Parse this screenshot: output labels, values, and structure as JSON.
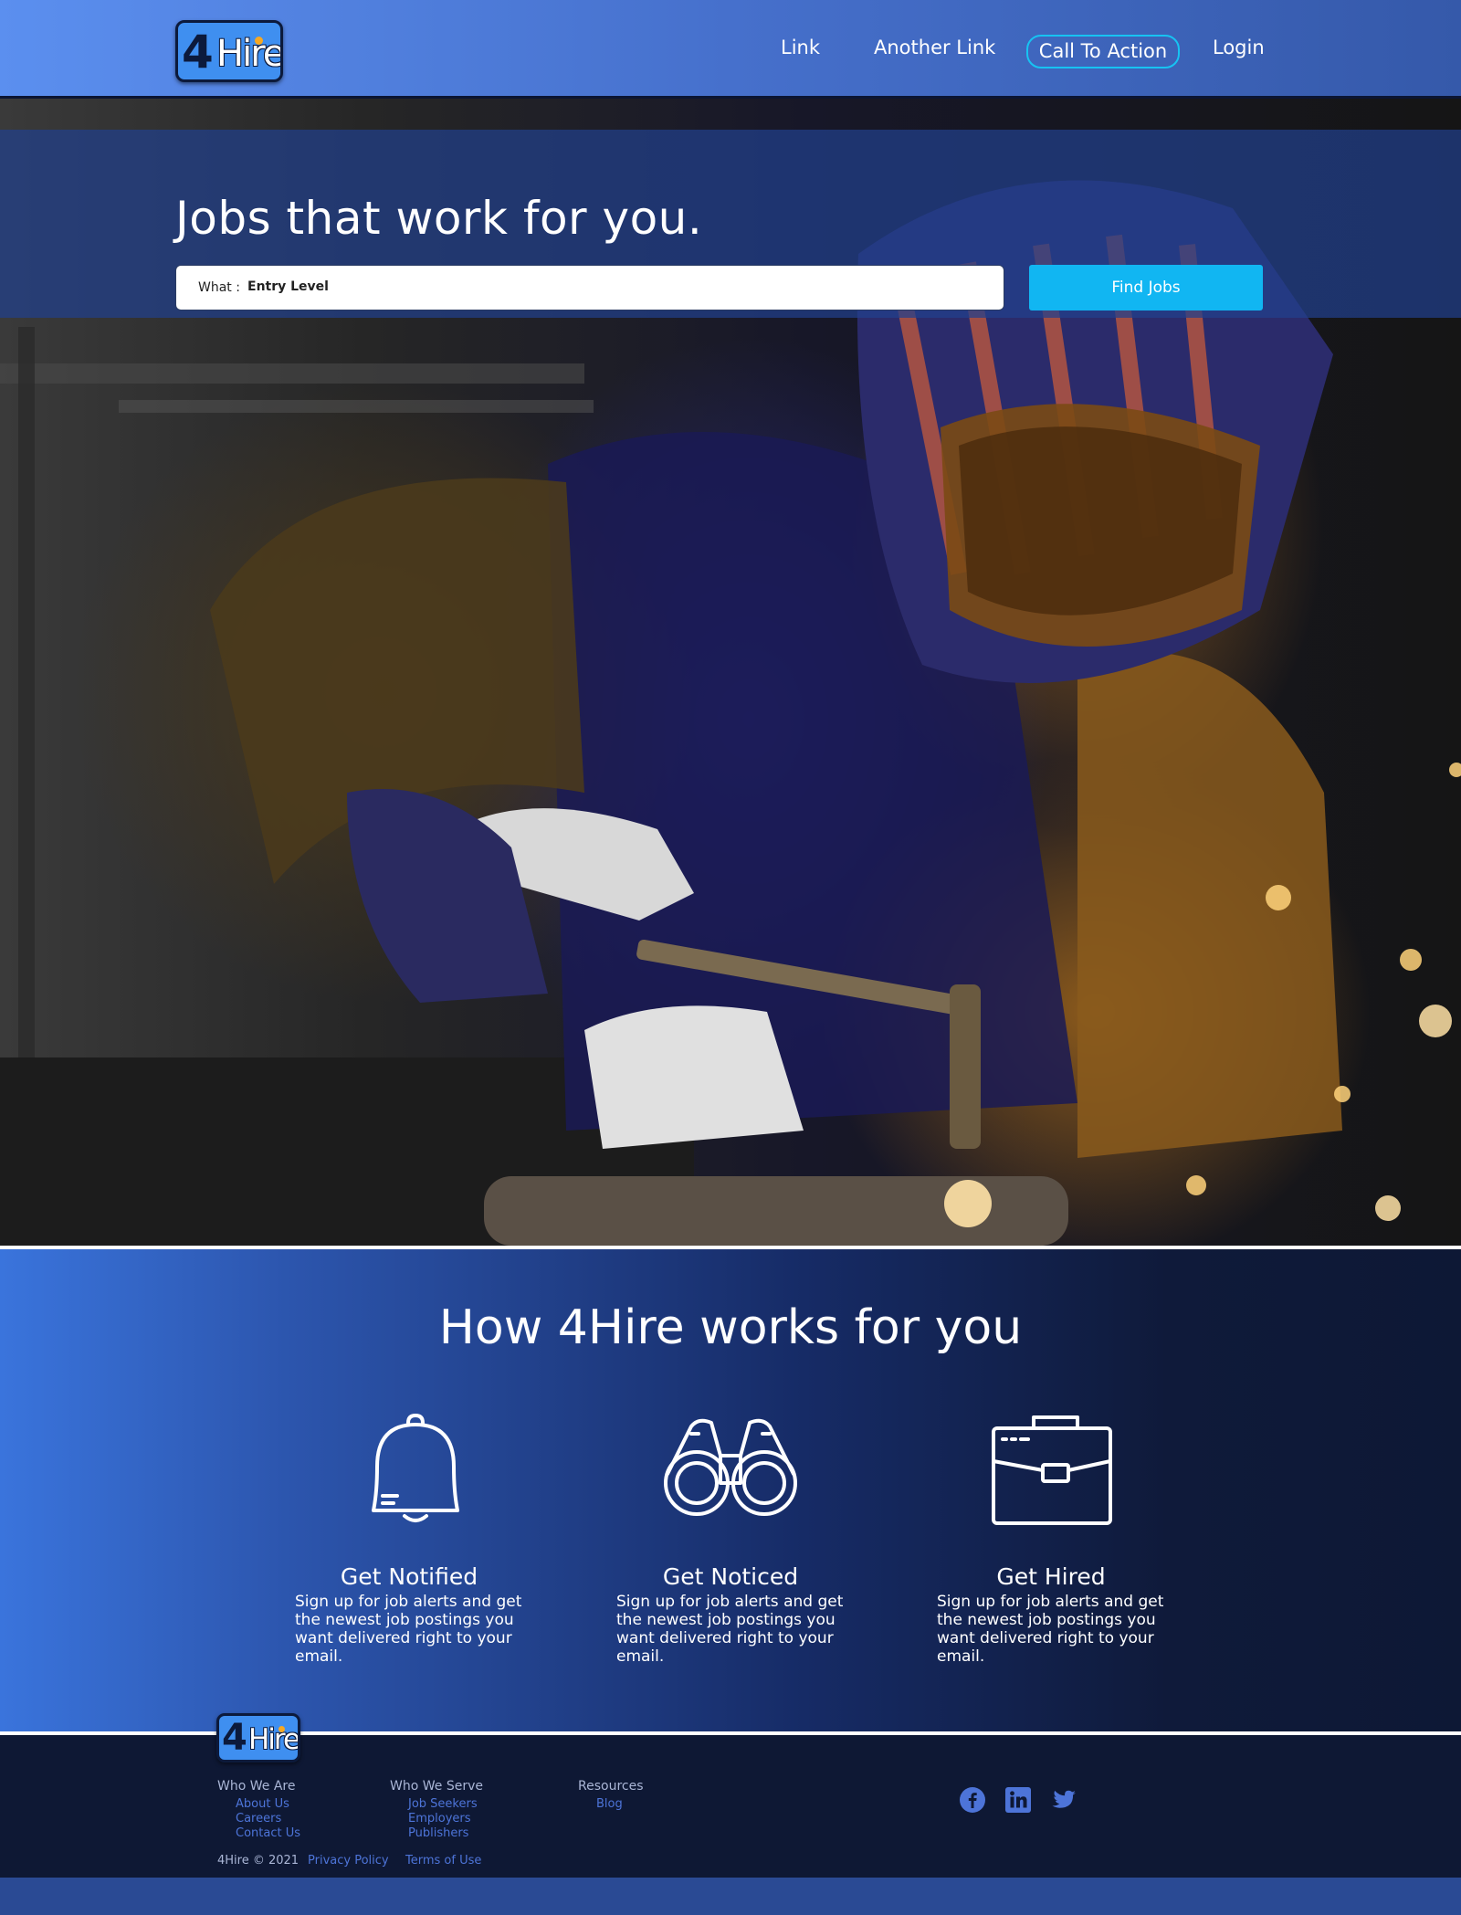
{
  "nav": {
    "logo_four": "4",
    "logo_hire": "Hire",
    "links": [
      "Link",
      "Another Link"
    ],
    "cta": "Call To Action",
    "login": "Login"
  },
  "hero": {
    "title": "Jobs that work for you.",
    "search": {
      "label": "What :",
      "value": "Entry Level"
    },
    "find_button": "Find Jobs"
  },
  "how": {
    "title": "How 4Hire works for you",
    "features": [
      {
        "icon": "bell-icon",
        "title": "Get Notified",
        "text": "Sign up for job alerts and get the newest job postings you want delivered right to your email."
      },
      {
        "icon": "binoculars-icon",
        "title": "Get Noticed",
        "text": "Sign up for job alerts and get the newest job postings you want delivered right to your email."
      },
      {
        "icon": "briefcase-icon",
        "title": "Get Hired",
        "text": "Sign up for job alerts and get the newest job postings you want delivered right to your email."
      }
    ]
  },
  "footer": {
    "logo_four": "4",
    "logo_hire": "Hire",
    "columns": [
      {
        "heading": "Who We Are",
        "links": [
          "About Us",
          "Careers",
          "Contact Us"
        ]
      },
      {
        "heading": "Who We Serve",
        "links": [
          "Job Seekers",
          "Employers",
          "Publishers"
        ]
      },
      {
        "heading": "Resources",
        "links": [
          "Blog"
        ]
      }
    ],
    "copyright": "4Hire © 2021",
    "legal": [
      "Privacy Policy",
      "Terms of Use"
    ],
    "social": [
      "facebook-icon",
      "linkedin-icon",
      "twitter-icon"
    ]
  },
  "colors": {
    "accent": "#11b6f2",
    "nav_blue": "#4670cc",
    "footer_bg": "#0e1834",
    "footer_link": "#4d74d8"
  }
}
